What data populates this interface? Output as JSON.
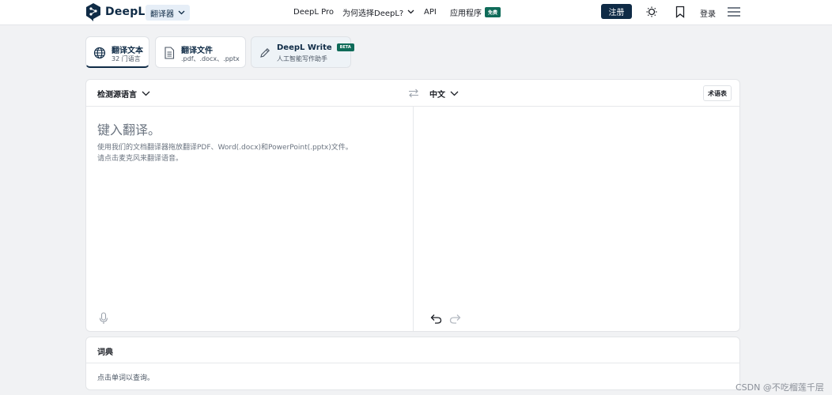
{
  "header": {
    "brand": "DeepL",
    "product_selector": "翻译器",
    "nav": {
      "pro": "DeepL Pro",
      "why": "为何选择DeepL?",
      "api": "API",
      "apps": "应用程序",
      "apps_badge": "免费"
    },
    "signup": "注册",
    "login": "登录",
    "icons": [
      "lightbulb-icon",
      "bookmark-icon",
      "menu-icon"
    ]
  },
  "modes": [
    {
      "title": "翻译文本",
      "subtitle": "32 门语言",
      "icon": "globe-icon",
      "active": true
    },
    {
      "title": "翻译文件",
      "subtitle": ".pdf、.docx、.pptx",
      "icon": "document-icon",
      "active": false
    },
    {
      "title": "DeepL Write",
      "badge": "BETA",
      "subtitle": "人工智能写作助手",
      "icon": "pen-icon",
      "active": false
    }
  ],
  "translator": {
    "source_lang": "检测源语言",
    "target_lang": "中文",
    "glossary": "术语表",
    "source_placeholder": "键入翻译。",
    "source_hint_line1": "使用我们的文档翻译器拖放翻译PDF、Word(.docx)和PowerPoint(.pptx)文件。",
    "source_hint_line2": "请点击麦克风来翻译语音。"
  },
  "dictionary": {
    "title": "词典",
    "hint": "点击单词以查询。"
  },
  "watermark": "CSDN @不吃榴莲千层",
  "colors": {
    "brand_navy": "#0f2b46",
    "badge_green": "#0f6b59",
    "page_bg": "#f1f2f4"
  }
}
